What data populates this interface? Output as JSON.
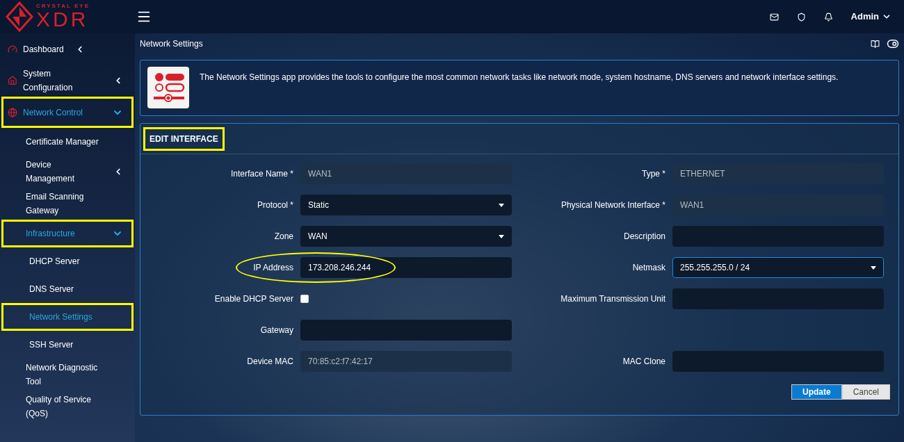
{
  "logo": {
    "tagline": "CRYSTAL EYE",
    "wordmark": "XDR"
  },
  "topbar": {
    "user": "Admin"
  },
  "sidebar": {
    "items": [
      {
        "label": "Dashboard",
        "kind": "group",
        "expanded": false,
        "selected": false,
        "highlighted": false
      },
      {
        "label": "System Configuration",
        "kind": "group",
        "expanded": false,
        "selected": false,
        "highlighted": false
      },
      {
        "label": "Network Control",
        "kind": "group",
        "expanded": true,
        "selected": true,
        "highlighted": true,
        "children": [
          {
            "label": "Certificate Manager",
            "kind": "link",
            "selected": false,
            "highlighted": false
          },
          {
            "label": "Device Management",
            "kind": "group",
            "expanded": false,
            "selected": false,
            "highlighted": false
          },
          {
            "label": "Email Scanning Gateway",
            "kind": "link",
            "selected": false,
            "highlighted": false
          },
          {
            "label": "Infrastructure",
            "kind": "group",
            "expanded": true,
            "selected": true,
            "highlighted": true,
            "children": [
              {
                "label": "DHCP Server",
                "selected": false,
                "highlighted": false
              },
              {
                "label": "DNS Server",
                "selected": false,
                "highlighted": false
              },
              {
                "label": "Network Settings",
                "selected": true,
                "highlighted": true
              },
              {
                "label": "SSH Server",
                "selected": false,
                "highlighted": false
              }
            ]
          },
          {
            "label": "Network Diagnostic Tool",
            "kind": "link",
            "selected": false,
            "highlighted": false
          },
          {
            "label": "Quality of Service (QoS)",
            "kind": "link",
            "selected": false,
            "highlighted": false
          }
        ]
      }
    ]
  },
  "page_title": "Network Settings",
  "info": {
    "text": "The Network Settings app provides the tools to configure the most common network tasks like network mode, system hostname, DNS servers and network interface settings."
  },
  "form": {
    "title": "EDIT INTERFACE",
    "title_highlighted": true,
    "rows": [
      {
        "left": {
          "label": "Interface Name *",
          "kind": "input",
          "value": "WAN1",
          "readonly": true,
          "focused": false
        },
        "right": {
          "label": "Type *",
          "kind": "input",
          "value": "ETHERNET",
          "readonly": true,
          "focused": false
        }
      },
      {
        "left": {
          "label": "Protocol *",
          "kind": "select",
          "value": "Static",
          "readonly": false,
          "focused": false
        },
        "right": {
          "label": "Physical Network Interface *",
          "kind": "input",
          "value": "WAN1",
          "readonly": true,
          "focused": false
        }
      },
      {
        "left": {
          "label": "Zone",
          "kind": "select",
          "value": "WAN",
          "readonly": false,
          "focused": false
        },
        "right": {
          "label": "Description",
          "kind": "input",
          "readonly": false,
          "focused": false
        }
      },
      {
        "left": {
          "label": "IP Address",
          "kind": "input",
          "value": "173.208.246.244",
          "readonly": false,
          "focused": false,
          "highlighted": true
        },
        "right": {
          "label": "Netmask",
          "kind": "select",
          "value": "255.255.255.0 / 24",
          "readonly": false,
          "focused": true
        }
      },
      {
        "left": {
          "label": "Enable DHCP Server",
          "kind": "checkbox",
          "checked": false
        },
        "right": {
          "label": "Maximum Transmission Unit",
          "kind": "input",
          "readonly": false,
          "focused": false
        }
      },
      {
        "left": {
          "label": "Gateway",
          "kind": "input",
          "readonly": false,
          "focused": false
        }
      },
      {
        "left": {
          "label": "Device MAC",
          "kind": "input",
          "value": "70:85:c2:f7:42:17",
          "readonly": true,
          "focused": false
        },
        "right": {
          "label": "MAC Clone",
          "kind": "input",
          "readonly": false,
          "focused": false
        }
      }
    ],
    "buttons": [
      {
        "label": "Update",
        "kind": "primary"
      },
      {
        "label": "Cancel",
        "kind": "secondary"
      }
    ]
  }
}
